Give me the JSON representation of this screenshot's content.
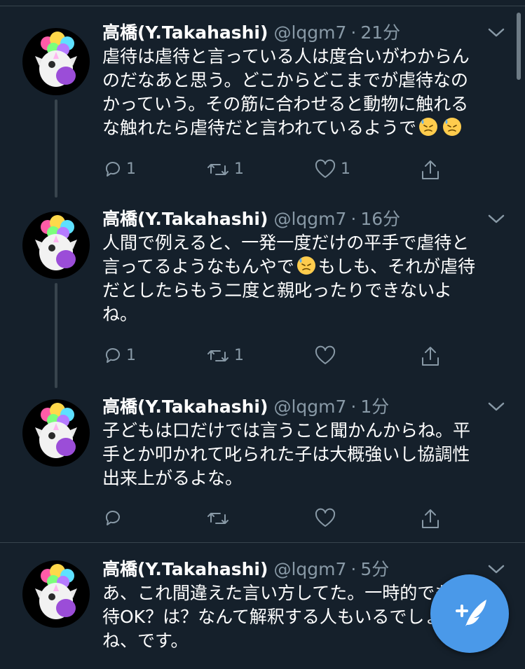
{
  "tweets": [
    {
      "display_name": "高橋(Y.Takahashi)",
      "handle": "@lqgm7",
      "separator": "·",
      "time": "21分",
      "lines": [
        "虐待は虐待と言っている人は度合いがわからん",
        "のだなあと思う。どこからどこまでが虐待なの",
        "かっていう。その筋に合わせると動物に触れる",
        "な触れたら虐待だと言われているようで"
      ],
      "trailing_emoji": [
        "downcast-face-with-sweat-emoji",
        "downcast-face-with-sweat-emoji"
      ],
      "replies": "1",
      "retweets": "1",
      "likes": "1"
    },
    {
      "display_name": "高橋(Y.Takahashi)",
      "handle": "@lqgm7",
      "separator": "·",
      "time": "16分",
      "lines": [
        "人間で例えると、一発一度だけの平手で虐待と",
        "言ってるようなもんやで",
        "だとしたらもう二度と親叱ったりできないよ",
        "ね。"
      ],
      "line2_after_emoji": "もしも、それが虐待",
      "inline_emoji": "downcast-face-with-sweat-emoji",
      "replies": "1",
      "retweets": "1",
      "likes": ""
    },
    {
      "display_name": "高橋(Y.Takahashi)",
      "handle": "@lqgm7",
      "separator": "·",
      "time": "1分",
      "lines": [
        "子どもは口だけでは言うこと聞かんからね。平",
        "手とか叩かれて叱られた子は大概強いし協調性",
        "出来上がるよな。"
      ],
      "replies": "",
      "retweets": "",
      "likes": ""
    },
    {
      "display_name": "高橋(Y.Takahashi)",
      "handle": "@lqgm7",
      "separator": "·",
      "time": "5分",
      "lines": [
        "あ、これ間違えた言い方してた。一時的でも虐",
        "待OK？は？なんて解釈する人もいるでしょう",
        "ね、です。"
      ]
    }
  ],
  "icons": {
    "reply": "reply-icon",
    "retweet": "retweet-icon",
    "like": "like-icon",
    "share": "share-icon",
    "more": "chevron-down-icon",
    "compose": "compose-tweet-icon",
    "avatar": "unicorn-rainbow-avatar"
  },
  "colors": {
    "background": "#15202b",
    "text": "#ffffff",
    "secondary_text": "#8899a6",
    "divider": "#38444d",
    "accent": "#4a99e9"
  }
}
